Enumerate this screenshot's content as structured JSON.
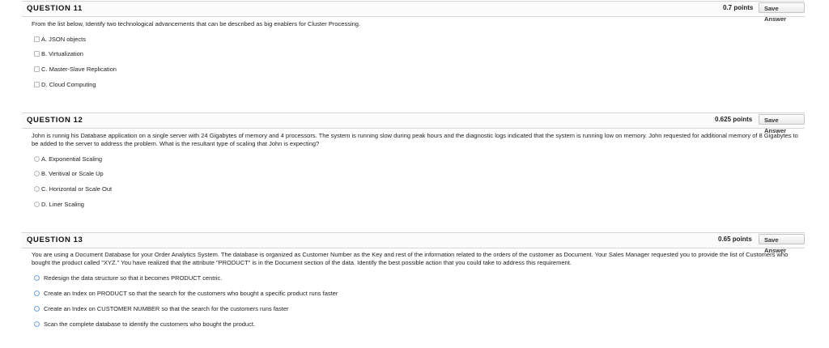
{
  "questions": [
    {
      "title": "QUESTION 11",
      "points": "0.7 points",
      "save_label": "Save Answer",
      "text": "From the list below, Identify two technological advancements that can be described as big enablers for Cluster Processing.",
      "options": [
        "A. JSON objects",
        "B. Virtualization",
        "C. Master-Slave Replication",
        "D. Cloud Computing"
      ],
      "control": "checkbox"
    },
    {
      "title": "QUESTION 12",
      "points": "0.625 points",
      "save_label": "Save Answer",
      "text": "John is runnig his Database application on a single server with 24 Gigabytes of memory and 4 processors. The system is running slow during peak hours and the diagnostic logs indicated that the system is running low on memory. John requested for additional memory of 8 Gigabytes to be added to the server to address the problem. What is the resultant type of scaling that John is expecting?",
      "options": [
        "A. Exponential Scaling",
        "B. Veritival or Scale Up",
        "C. Horizontal or Scale Out",
        "D. Liner Scaling"
      ],
      "control": "radio"
    },
    {
      "title": "QUESTION 13",
      "points": "0.65 points",
      "save_label": "Save Answer",
      "text": "You are using a Document Database for your Order Analytics System. The database is organized as Customer Number as the Key and rest of the information related to the orders of the customer as Document. Your Sales Manager requested you to provide the list of Customers who bought the product called \"XYZ.\" You have realized that the attribute \"PRODUCT\" is in the Document section of the data. Identify the best possible action that you could take to address this requirement.",
      "options": [
        "Redesign the data structure so that it becomes PRODUCT centric.",
        "Create an Index on PRODUCT so that the search for the customers who bought a specific product runs faster",
        "Create an Index on CUSTOMER NUMBER so that the search for the customers runs faster",
        "Scan the complete database to identify the customers who bought the product."
      ],
      "control": "radio"
    }
  ]
}
